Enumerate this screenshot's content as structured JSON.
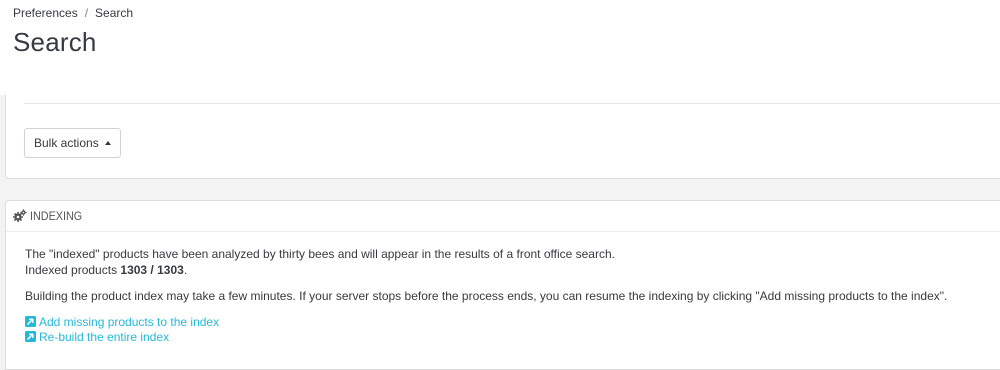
{
  "breadcrumb": {
    "items": [
      "Preferences",
      "Search"
    ],
    "separator": "/"
  },
  "page": {
    "title": "Search"
  },
  "toolbar": {
    "bulk_actions_label": "Bulk actions"
  },
  "indexing": {
    "heading": "INDEXING",
    "heading_icon": "cogs-icon",
    "description": "The \"indexed\" products have been analyzed by thirty bees and will appear in the results of a front office search.",
    "indexed_label": "Indexed products",
    "indexed_count": "1303 / 1303",
    "indexed_suffix": ".",
    "note": "Building the product index may take a few minutes. If your server stops before the process ends, you can resume the indexing by clicking \"Add missing products to the index\".",
    "links": [
      {
        "label": "Add missing products to the index",
        "icon": "external-link-icon"
      },
      {
        "label": "Re-build the entire index",
        "icon": "external-link-icon"
      }
    ]
  },
  "colors": {
    "link": "#25b9d7",
    "text": "#363a41",
    "background": "#f3f3f3"
  }
}
